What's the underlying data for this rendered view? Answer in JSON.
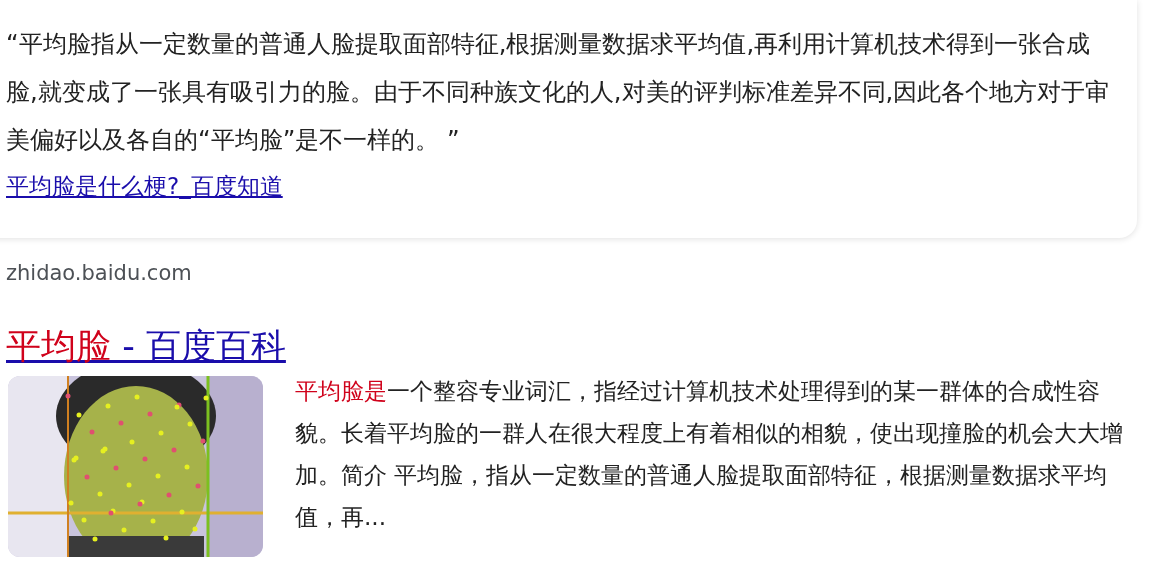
{
  "answer_card": {
    "quote": "“平均脸指从一定数量的普通人脸提取面部特征,根据测量数据求平均值,再利用计算机技术得到一张合成脸,就变成了一张具有吸引力的脸。由于不同种族文化的人,对美的评判标准差异不同,因此各个地方对于审美偏好以及各自的“平均脸”是不一样的。 ”",
    "source_link": "平均脸是什么梗?_百度知道"
  },
  "domain": "zhidao.baidu.com",
  "result": {
    "title": [
      {
        "text": "平均脸",
        "highlighted": true
      },
      {
        "text": " - 百度百科",
        "highlighted": false
      }
    ],
    "snippet": [
      {
        "text": "平均脸是",
        "highlighted": true
      },
      {
        "text": "一个整容专业词汇，指经过计算机技术处理得到的某一群体的合成性容貌。长着平均脸的一群人在很大程度上有着相似的相貌，使出现撞脸的机会大大增加。简介 平均脸，指从一定数量的普通人脸提取面部特征，根据测量数据求平均值，再...",
        "highlighted": false
      }
    ]
  }
}
